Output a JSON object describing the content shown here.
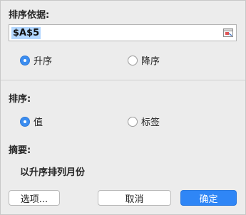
{
  "dialog": {
    "sort_basis_label": "排序依据:",
    "reference_value": "$A$5",
    "collapse_icon": "range-collapse-icon",
    "order_options": [
      {
        "label": "升序",
        "selected": true
      },
      {
        "label": "降序",
        "selected": false
      }
    ],
    "sort_label": "排序:",
    "sort_by_options": [
      {
        "label": "值",
        "selected": true
      },
      {
        "label": "标签",
        "selected": false
      }
    ],
    "summary_label": "摘要:",
    "summary_text": "以升序排列月份",
    "buttons": {
      "options": "选项...",
      "cancel": "取消",
      "ok": "确定"
    }
  },
  "colors": {
    "accent": "#2f86f6",
    "selection": "#b3d7ff",
    "background": "#ececec"
  }
}
